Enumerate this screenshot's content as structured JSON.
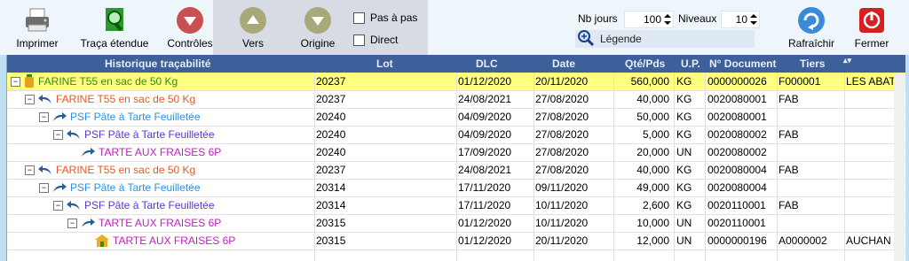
{
  "toolbar": {
    "print": "Imprimer",
    "trace": "Traça étendue",
    "controls": "Contrôles",
    "to": "Vers",
    "origin": "Origine",
    "step": "Pas à pas",
    "direct": "Direct",
    "nb_days_label": "Nb jours",
    "nb_days": "100",
    "levels_label": "Niveaux",
    "levels": "10",
    "legend": "Légende",
    "refresh": "Rafraîchir",
    "close": "Fermer"
  },
  "columns": {
    "history": "Historique traçabilité",
    "lot": "Lot",
    "dlc": "DLC",
    "date": "Date",
    "qty": "Qté/Pds",
    "up": "U.P.",
    "doc": "N° Document",
    "tiers": "Tiers"
  },
  "colors": {
    "orange": "#e8582a",
    "blue": "#2f8fe0",
    "purple": "#5a35c8",
    "magenta": "#c020c0",
    "green": "#3a8a10"
  },
  "rows": [
    {
      "label": "FARINE T55 en sac de 50 Kg",
      "color": "green",
      "lot": "20237",
      "dlc": "01/12/2020",
      "date": "20/11/2020",
      "qty": "560,000",
      "up": "KG",
      "doc": "0000000026",
      "tiers": "F000001",
      "extra": "LES ABATT",
      "expander": "−",
      "icon": "bottle"
    },
    {
      "label": "FARINE T55 en sac de 50 Kg",
      "color": "orange",
      "lot": "20237",
      "dlc": "24/08/2021",
      "date": "27/08/2020",
      "qty": "40,000",
      "up": "KG",
      "doc": "0020080001",
      "tiers": "FAB",
      "extra": "",
      "expander": "−",
      "icon": "arrow-back"
    },
    {
      "label": "PSF Pâte à Tarte Feuilletée",
      "color": "blue",
      "lot": "20240",
      "dlc": "04/09/2020",
      "date": "27/08/2020",
      "qty": "50,000",
      "up": "KG",
      "doc": "0020080001",
      "tiers": "",
      "extra": "",
      "expander": "−",
      "icon": "arrow-fwd"
    },
    {
      "label": "PSF Pâte à Tarte Feuilletée",
      "color": "purple",
      "lot": "20240",
      "dlc": "04/09/2020",
      "date": "27/08/2020",
      "qty": "5,000",
      "up": "KG",
      "doc": "0020080002",
      "tiers": "FAB",
      "extra": "",
      "expander": "−",
      "icon": "arrow-back"
    },
    {
      "label": "TARTE AUX FRAISES 6P",
      "color": "magenta",
      "lot": "20240",
      "dlc": "17/09/2020",
      "date": "27/08/2020",
      "qty": "20,000",
      "up": "UN",
      "doc": "0020080002",
      "tiers": "",
      "extra": "",
      "expander": "",
      "icon": "arrow-fwd"
    },
    {
      "label": "FARINE T55 en sac de 50 Kg",
      "color": "orange",
      "lot": "20237",
      "dlc": "24/08/2021",
      "date": "27/08/2020",
      "qty": "40,000",
      "up": "KG",
      "doc": "0020080004",
      "tiers": "FAB",
      "extra": "",
      "expander": "−",
      "icon": "arrow-back"
    },
    {
      "label": "PSF Pâte à Tarte Feuilletée",
      "color": "blue",
      "lot": "20314",
      "dlc": "17/11/2020",
      "date": "09/11/2020",
      "qty": "49,000",
      "up": "KG",
      "doc": "0020080004",
      "tiers": "",
      "extra": "",
      "expander": "−",
      "icon": "arrow-fwd"
    },
    {
      "label": "PSF Pâte à Tarte Feuilletée",
      "color": "purple",
      "lot": "20314",
      "dlc": "17/11/2020",
      "date": "10/11/2020",
      "qty": "2,600",
      "up": "KG",
      "doc": "0020110001",
      "tiers": "FAB",
      "extra": "",
      "expander": "−",
      "icon": "arrow-back"
    },
    {
      "label": "TARTE AUX FRAISES 6P",
      "color": "magenta",
      "lot": "20315",
      "dlc": "01/12/2020",
      "date": "10/11/2020",
      "qty": "10,000",
      "up": "UN",
      "doc": "0020110001",
      "tiers": "",
      "extra": "",
      "expander": "−",
      "icon": "arrow-fwd"
    },
    {
      "label": "TARTE AUX FRAISES 6P",
      "color": "magenta",
      "lot": "20315",
      "dlc": "01/12/2020",
      "date": "20/11/2020",
      "qty": "12,000",
      "up": "UN",
      "doc": "0000000196",
      "tiers": "A0000002",
      "extra": "AUCHAN L",
      "expander": "",
      "icon": "house"
    }
  ]
}
